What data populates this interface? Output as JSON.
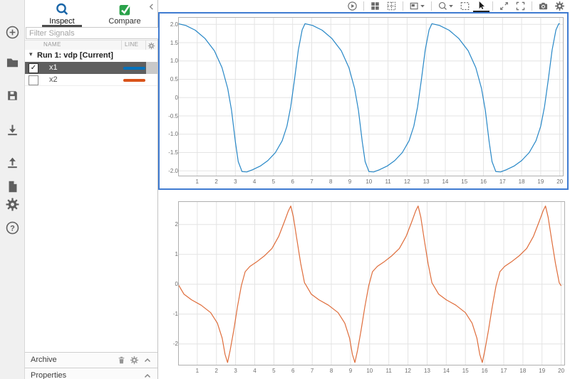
{
  "left_toolbar": {
    "items": [
      {
        "name": "new",
        "icon": "plus-circle"
      },
      {
        "name": "open",
        "icon": "folder"
      },
      {
        "name": "save",
        "icon": "floppy"
      },
      {
        "name": "import",
        "icon": "arrow-down"
      },
      {
        "name": "export",
        "icon": "arrow-up"
      },
      {
        "name": "create-report",
        "icon": "document"
      },
      {
        "name": "preferences",
        "icon": "gear"
      },
      {
        "name": "help",
        "icon": "question-circle"
      }
    ]
  },
  "sidebar": {
    "collapse_icon": "chevron-left",
    "tabs": [
      {
        "label": "Inspect",
        "icon": "magnifier",
        "active": true
      },
      {
        "label": "Compare",
        "icon": "compare-check",
        "active": false
      }
    ],
    "filter": {
      "placeholder": "Filter Signals"
    },
    "table": {
      "columns": [
        "NAME",
        "LINE"
      ],
      "header_gear_icon": "gear",
      "group": {
        "label": "Run 1: vdp [Current]",
        "expanded": true
      },
      "rows": [
        {
          "name": "x1",
          "checked": true,
          "selected": true,
          "line_color": "#0072BD"
        },
        {
          "name": "x2",
          "checked": false,
          "selected": false,
          "line_color": "#D95319"
        }
      ]
    },
    "archive": {
      "label": "Archive",
      "icons": [
        "trash",
        "gear",
        "chevron-up"
      ]
    },
    "properties": {
      "label": "Properties",
      "icons": [
        "chevron-up"
      ]
    }
  },
  "plot_toolbar": {
    "items": [
      {
        "type": "button",
        "name": "play",
        "icon": "play"
      },
      {
        "type": "separator"
      },
      {
        "type": "button",
        "name": "layout-grid",
        "icon": "layout-grid"
      },
      {
        "type": "button",
        "name": "layout-custom",
        "icon": "layout-custom"
      },
      {
        "type": "separator"
      },
      {
        "type": "button",
        "name": "display-options",
        "icon": "display-options",
        "caret": true
      },
      {
        "type": "separator"
      },
      {
        "type": "button",
        "name": "zoom-menu",
        "icon": "zoom",
        "caret": true
      },
      {
        "type": "button",
        "name": "fit-to-view",
        "icon": "fit-view"
      },
      {
        "type": "button",
        "name": "select-cursor",
        "icon": "cursor",
        "active": true
      },
      {
        "type": "separator"
      },
      {
        "type": "button",
        "name": "pan",
        "icon": "pan-arrows"
      },
      {
        "type": "button",
        "name": "fullscreen",
        "icon": "fullscreen"
      },
      {
        "type": "separator"
      },
      {
        "type": "button",
        "name": "snapshot",
        "icon": "camera"
      },
      {
        "type": "button",
        "name": "plot-settings",
        "icon": "gear"
      }
    ]
  },
  "chart_data": [
    {
      "type": "line",
      "title": "",
      "xlabel": "",
      "ylabel": "",
      "selected": true,
      "xlim": [
        0,
        20.2
      ],
      "ylim": [
        -2.15,
        2.2
      ],
      "grid": true,
      "xticks": {
        "values": [
          1,
          2,
          3,
          4,
          5,
          6,
          7,
          8,
          9,
          10,
          11,
          12,
          13,
          14,
          15,
          16,
          17,
          18,
          19,
          20
        ],
        "labels": [
          "1",
          "2",
          "3",
          "4",
          "5",
          "6",
          "7",
          "8",
          "9",
          "10",
          "11",
          "12",
          "13",
          "14",
          "15",
          "16",
          "17",
          "18",
          "19",
          "20"
        ]
      },
      "yticks": {
        "values": [
          2,
          1.5,
          1,
          0.5,
          0,
          -0.5,
          -1,
          -1.5,
          -2
        ],
        "labels": [
          "2.0",
          "1.5",
          "1.0",
          "0.5",
          "0",
          "-0.5",
          "-1.0",
          "-1.5",
          "-2.0"
        ]
      },
      "series": [
        {
          "name": "x1",
          "color": "#0072BD",
          "points": [
            [
              0,
              2.02
            ],
            [
              0.4,
              1.97
            ],
            [
              0.9,
              1.84
            ],
            [
              1.4,
              1.62
            ],
            [
              1.9,
              1.28
            ],
            [
              2.3,
              0.82
            ],
            [
              2.6,
              0.25
            ],
            [
              2.8,
              -0.35
            ],
            [
              3,
              -1.2
            ],
            [
              3.15,
              -1.75
            ],
            [
              3.35,
              -2.02
            ],
            [
              3.6,
              -2.03
            ],
            [
              3.9,
              -1.97
            ],
            [
              4.3,
              -1.87
            ],
            [
              4.7,
              -1.72
            ],
            [
              5.1,
              -1.5
            ],
            [
              5.45,
              -1.18
            ],
            [
              5.7,
              -0.78
            ],
            [
              5.9,
              -0.25
            ],
            [
              6.1,
              0.5
            ],
            [
              6.3,
              1.3
            ],
            [
              6.5,
              1.85
            ],
            [
              6.65,
              2.02
            ],
            [
              7.05,
              1.97
            ],
            [
              7.55,
              1.84
            ],
            [
              8.05,
              1.62
            ],
            [
              8.55,
              1.28
            ],
            [
              8.95,
              0.82
            ],
            [
              9.25,
              0.25
            ],
            [
              9.45,
              -0.35
            ],
            [
              9.65,
              -1.2
            ],
            [
              9.8,
              -1.75
            ],
            [
              10,
              -2.02
            ],
            [
              10.25,
              -2.03
            ],
            [
              10.55,
              -1.97
            ],
            [
              10.95,
              -1.87
            ],
            [
              11.35,
              -1.72
            ],
            [
              11.75,
              -1.5
            ],
            [
              12.1,
              -1.18
            ],
            [
              12.35,
              -0.78
            ],
            [
              12.55,
              -0.25
            ],
            [
              12.75,
              0.5
            ],
            [
              12.95,
              1.3
            ],
            [
              13.15,
              1.85
            ],
            [
              13.3,
              2.02
            ],
            [
              13.7,
              1.97
            ],
            [
              14.2,
              1.84
            ],
            [
              14.7,
              1.62
            ],
            [
              15.2,
              1.28
            ],
            [
              15.6,
              0.82
            ],
            [
              15.9,
              0.25
            ],
            [
              16.1,
              -0.35
            ],
            [
              16.3,
              -1.2
            ],
            [
              16.45,
              -1.75
            ],
            [
              16.65,
              -2.02
            ],
            [
              16.9,
              -2.03
            ],
            [
              17.2,
              -1.97
            ],
            [
              17.6,
              -1.87
            ],
            [
              18,
              -1.72
            ],
            [
              18.4,
              -1.5
            ],
            [
              18.75,
              -1.18
            ],
            [
              19,
              -0.78
            ],
            [
              19.2,
              -0.25
            ],
            [
              19.4,
              0.5
            ],
            [
              19.6,
              1.3
            ],
            [
              19.8,
              1.85
            ],
            [
              19.95,
              2.02
            ],
            [
              20,
              2.01
            ]
          ]
        }
      ]
    },
    {
      "type": "line",
      "title": "",
      "xlabel": "",
      "ylabel": "",
      "selected": false,
      "xlim": [
        0,
        20.2
      ],
      "ylim": [
        -2.72,
        2.78
      ],
      "grid": true,
      "xticks": {
        "values": [
          1,
          2,
          3,
          4,
          5,
          6,
          7,
          8,
          9,
          10,
          11,
          12,
          13,
          14,
          15,
          16,
          17,
          18,
          19,
          20
        ],
        "labels": [
          "1",
          "2",
          "3",
          "4",
          "5",
          "6",
          "7",
          "8",
          "9",
          "10",
          "11",
          "12",
          "13",
          "14",
          "15",
          "16",
          "17",
          "18",
          "19",
          "20"
        ]
      },
      "yticks": {
        "values": [
          2,
          1,
          0,
          -1,
          -2
        ],
        "labels": [
          "2",
          "1",
          "0",
          "-1",
          "-2"
        ]
      },
      "series": [
        {
          "name": "x2",
          "color": "#D95319",
          "points": [
            [
              0,
              0
            ],
            [
              0.3,
              -0.33
            ],
            [
              0.7,
              -0.52
            ],
            [
              1.2,
              -0.7
            ],
            [
              1.7,
              -0.95
            ],
            [
              2.05,
              -1.3
            ],
            [
              2.3,
              -1.8
            ],
            [
              2.45,
              -2.35
            ],
            [
              2.58,
              -2.62
            ],
            [
              2.72,
              -2.2
            ],
            [
              2.9,
              -1.55
            ],
            [
              3.1,
              -0.75
            ],
            [
              3.3,
              -0.05
            ],
            [
              3.5,
              0.42
            ],
            [
              3.75,
              0.6
            ],
            [
              4.1,
              0.75
            ],
            [
              4.5,
              0.95
            ],
            [
              4.9,
              1.2
            ],
            [
              5.25,
              1.6
            ],
            [
              5.55,
              2.1
            ],
            [
              5.75,
              2.45
            ],
            [
              5.88,
              2.62
            ],
            [
              6.02,
              2.25
            ],
            [
              6.2,
              1.5
            ],
            [
              6.4,
              0.7
            ],
            [
              6.6,
              0.05
            ],
            [
              6.65,
              0
            ],
            [
              6.95,
              -0.33
            ],
            [
              7.35,
              -0.52
            ],
            [
              7.85,
              -0.7
            ],
            [
              8.35,
              -0.95
            ],
            [
              8.7,
              -1.3
            ],
            [
              8.95,
              -1.8
            ],
            [
              9.1,
              -2.35
            ],
            [
              9.23,
              -2.62
            ],
            [
              9.37,
              -2.2
            ],
            [
              9.55,
              -1.55
            ],
            [
              9.75,
              -0.75
            ],
            [
              9.95,
              -0.05
            ],
            [
              10.15,
              0.42
            ],
            [
              10.4,
              0.6
            ],
            [
              10.75,
              0.75
            ],
            [
              11.15,
              0.95
            ],
            [
              11.55,
              1.2
            ],
            [
              11.9,
              1.6
            ],
            [
              12.2,
              2.1
            ],
            [
              12.4,
              2.45
            ],
            [
              12.53,
              2.62
            ],
            [
              12.67,
              2.25
            ],
            [
              12.85,
              1.5
            ],
            [
              13.05,
              0.7
            ],
            [
              13.25,
              0.05
            ],
            [
              13.3,
              0
            ],
            [
              13.6,
              -0.33
            ],
            [
              14,
              -0.52
            ],
            [
              14.5,
              -0.7
            ],
            [
              15,
              -0.95
            ],
            [
              15.35,
              -1.3
            ],
            [
              15.6,
              -1.8
            ],
            [
              15.75,
              -2.35
            ],
            [
              15.88,
              -2.62
            ],
            [
              16.02,
              -2.2
            ],
            [
              16.2,
              -1.55
            ],
            [
              16.4,
              -0.75
            ],
            [
              16.6,
              -0.05
            ],
            [
              16.8,
              0.42
            ],
            [
              17.05,
              0.6
            ],
            [
              17.4,
              0.75
            ],
            [
              17.8,
              0.95
            ],
            [
              18.2,
              1.2
            ],
            [
              18.55,
              1.6
            ],
            [
              18.85,
              2.1
            ],
            [
              19.05,
              2.45
            ],
            [
              19.18,
              2.62
            ],
            [
              19.32,
              2.25
            ],
            [
              19.5,
              1.5
            ],
            [
              19.7,
              0.7
            ],
            [
              19.9,
              0.05
            ],
            [
              20,
              -0.05
            ]
          ]
        }
      ]
    }
  ]
}
